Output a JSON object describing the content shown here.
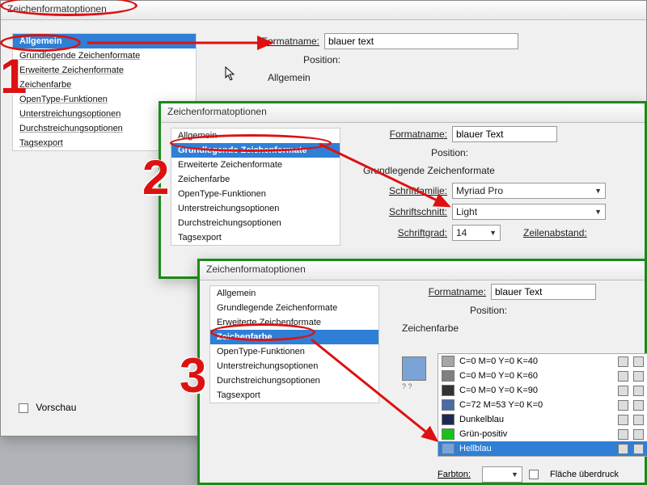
{
  "dialog_title": "Zeichenformatoptionen",
  "sidebar_items": [
    "Allgemein",
    "Grundlegende Zeichenformate",
    "Erweiterte Zeichenformate",
    "Zeichenfarbe",
    "OpenType-Funktionen",
    "Unterstreichungsoptionen",
    "Durchstreichungsoptionen",
    "Tagsexport"
  ],
  "formatname_label": "Formatname:",
  "position_label": "Position:",
  "panel1": {
    "selected_index": 0,
    "formatname_value": "blauer text",
    "section_heading": "Allgemein",
    "preview_label": "Vorschau"
  },
  "panel2": {
    "selected_index": 1,
    "formatname_value": "blauer Text",
    "section_heading": "Grundlegende Zeichenformate",
    "schriftfamilie_label": "Schriftfamilie:",
    "schriftfamilie_value": "Myriad Pro",
    "schriftschnitt_label": "Schriftschnitt:",
    "schriftschnitt_value": "Light",
    "schriftgrad_label": "Schriftgrad:",
    "schriftgrad_value": "14",
    "zeilenabstand_label": "Zeilenabstand:"
  },
  "panel3": {
    "selected_index": 3,
    "formatname_value": "blauer Text",
    "section_heading": "Zeichenfarbe",
    "farbton_label": "Farbton:",
    "fill_option": "Fläche überdruck",
    "colors": [
      {
        "name": "C=0 M=0 Y=0 K=40",
        "hex": "#a6a6a6"
      },
      {
        "name": "C=0 M=0 Y=0 K=60",
        "hex": "#808080"
      },
      {
        "name": "C=0 M=0 Y=0 K=90",
        "hex": "#333333"
      },
      {
        "name": "C=72 M=53 Y=0 K=0",
        "hex": "#4a6aa8"
      },
      {
        "name": "Dunkelblau",
        "hex": "#1b2a55"
      },
      {
        "name": "Grün-positiv",
        "hex": "#18c218"
      },
      {
        "name": "Hellblau",
        "hex": "#7aa3d6"
      }
    ],
    "selected_color_index": 6,
    "preview_hex": "#7aa3d6"
  },
  "annotations": {
    "n1": "1",
    "n2": "2",
    "n3": "3"
  }
}
